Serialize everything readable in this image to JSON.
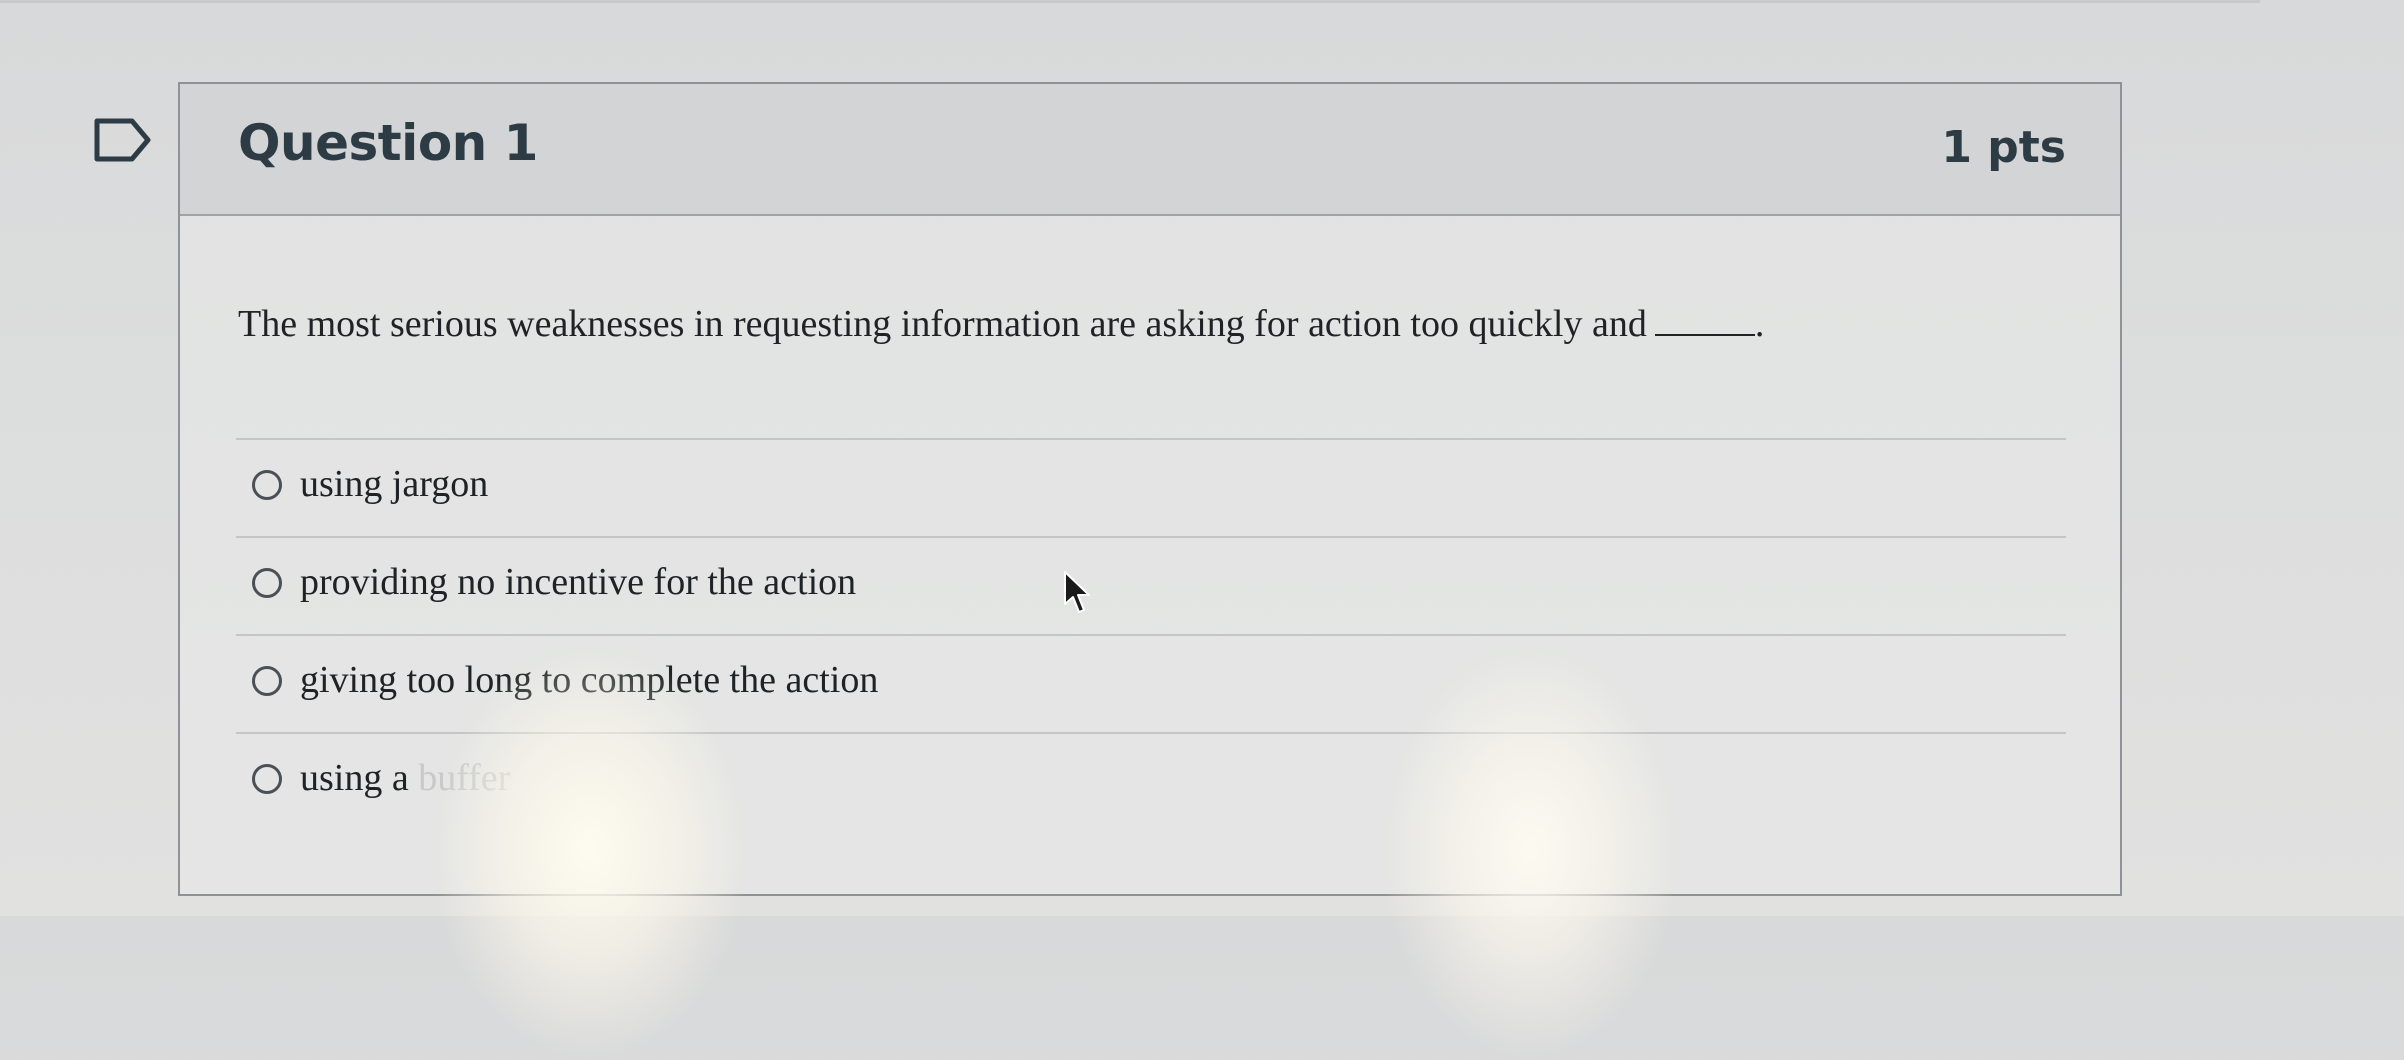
{
  "question": {
    "title": "Question 1",
    "points": "1 pts",
    "text": "The most serious weaknesses in requesting information are asking for action too quickly and",
    "blank_suffix": "."
  },
  "answers": [
    {
      "label": "using jargon"
    },
    {
      "label": "providing no incentive for the action"
    },
    {
      "label": "giving too long to complete the action"
    },
    {
      "label_visible": "using a ",
      "label_faded": "buffer"
    }
  ],
  "icons": {
    "flag": "bookmark-flag-icon",
    "cursor": "mouse-pointer-icon"
  },
  "colors": {
    "title": "#2d3b45",
    "header_bg": "#d3d4d5",
    "border": "#8f9296"
  }
}
